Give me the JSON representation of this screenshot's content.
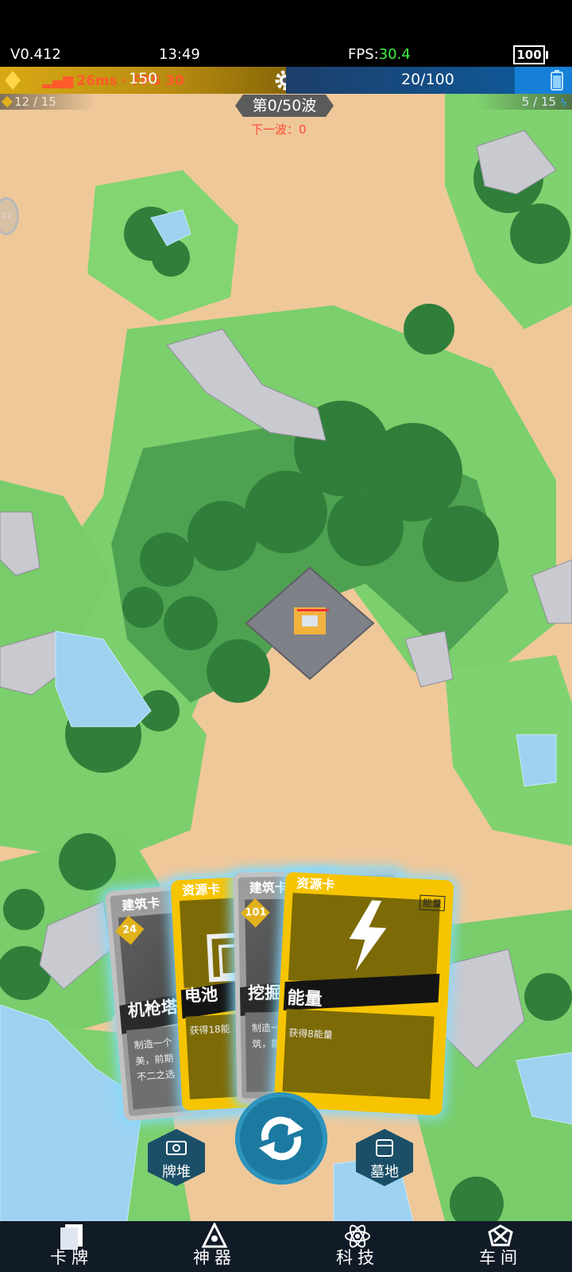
{
  "status_bar": {
    "version": "V0.412",
    "time": "13:49",
    "fps_label": "FPS:",
    "fps_value": "30.4",
    "battery": "100"
  },
  "hud": {
    "gold": "150",
    "ping": "26ms · FPS 30",
    "energy": "20/100",
    "left_counter": "12 / 15",
    "right_counter": "5 / 15",
    "wave": "第0/50波",
    "next_wave": "下一波：0",
    "side_badge": "22",
    "colors": {
      "gold": "#d8a915",
      "energy": "#0f5795",
      "ping": "#ff5a2a",
      "next_wave": "#ff4a36"
    }
  },
  "cards": [
    {
      "type": "建筑卡",
      "cost": "24",
      "title": "机枪塔",
      "desc": "制造一个\n美，前期\n不二之选",
      "style": "gray"
    },
    {
      "type": "资源卡",
      "title": "电池",
      "desc": "获得18能",
      "style": "gold"
    },
    {
      "type": "建筑卡",
      "cost": "101",
      "title": "挖掘塔",
      "desc": "制造一个\n筑，能快",
      "style": "gray"
    },
    {
      "type": "资源卡",
      "tag": "能量",
      "title": "能量",
      "desc": "获得8能量",
      "style": "gold"
    }
  ],
  "actions": {
    "deck": "牌堆",
    "graveyard": "墓地",
    "refresh_icon": "refresh-icon"
  },
  "nav": [
    {
      "label": "卡牌",
      "icon": "cards-icon"
    },
    {
      "label": "神器",
      "icon": "artifact-icon"
    },
    {
      "label": "科技",
      "icon": "atom-icon"
    },
    {
      "label": "车间",
      "icon": "workshop-icon"
    }
  ]
}
